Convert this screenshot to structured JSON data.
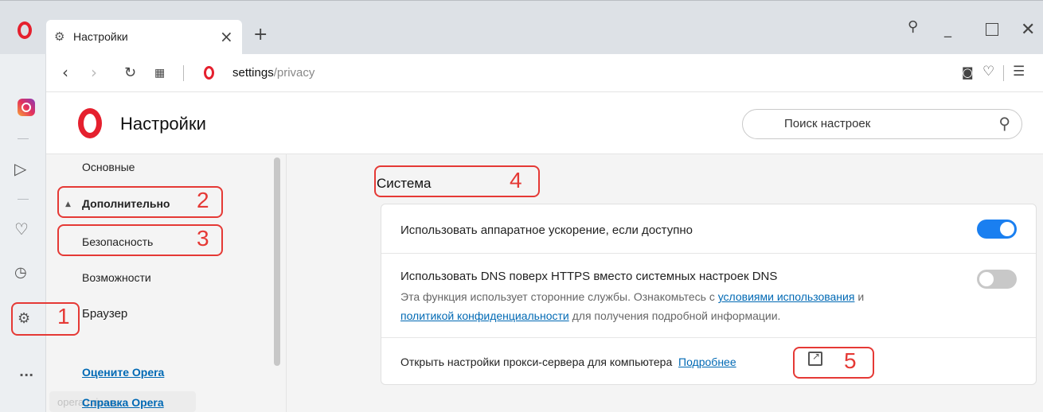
{
  "browser": {
    "tab_title": "Настройки",
    "tab_close": "×",
    "newtab": "+",
    "url_host": "settings",
    "url_path": "/privacy"
  },
  "header": {
    "title": "Настройки",
    "search_placeholder": "Поиск настроек"
  },
  "nav": {
    "items": [
      "Основные",
      "Дополнительно",
      "Безопасность",
      "Возможности",
      "Браузер"
    ],
    "links": [
      "Оцените Opera",
      "Справка Opera"
    ],
    "faded_text": "opera privacy"
  },
  "main": {
    "section_title": "Система",
    "rows": [
      {
        "text": "Использовать аппаратное ускорение, если доступно",
        "toggle": "on"
      },
      {
        "text": "Использовать DNS поверх HTTPS вместо системных настроек DNS",
        "sub_pre": "Эта функция использует сторонние службы. Ознакомьтесь с ",
        "sub_link1": "условиями использования",
        "sub_mid": " и",
        "sub_link2": "политикой конфиденциальности",
        "sub_post": " для получения подробной информации.",
        "toggle": "off"
      },
      {
        "text": "Открыть настройки прокси-сервера для компьютера",
        "link": "Подробнее"
      }
    ]
  },
  "annotations": [
    "1",
    "2",
    "3",
    "4",
    "5"
  ],
  "colors": {
    "accent_blue": "#1a7ff0",
    "opera_red": "#e5202e",
    "annotation_red": "#e53935",
    "link_blue": "#0069b4"
  }
}
